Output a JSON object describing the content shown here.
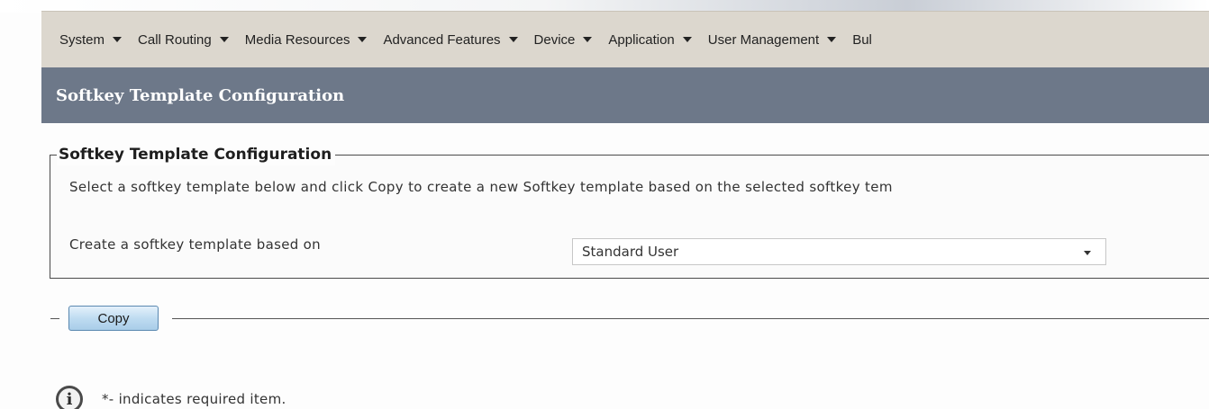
{
  "menubar": {
    "items": [
      {
        "label": "System",
        "icon": "chevron-down-icon"
      },
      {
        "label": "Call Routing",
        "icon": "chevron-down-icon"
      },
      {
        "label": "Media Resources",
        "icon": "chevron-down-icon"
      },
      {
        "label": "Advanced Features",
        "icon": "chevron-down-icon"
      },
      {
        "label": "Device",
        "icon": "chevron-down-icon"
      },
      {
        "label": "Application",
        "icon": "chevron-down-icon"
      },
      {
        "label": "User Management",
        "icon": "chevron-down-icon"
      },
      {
        "label": "Bul",
        "icon": ""
      }
    ]
  },
  "page": {
    "title": "Softkey Template Configuration"
  },
  "section": {
    "legend": "Softkey Template Configuration",
    "description": "Select a softkey template below and click Copy to create a new Softkey template based on the selected softkey tem",
    "field_label": "Create a softkey template based on",
    "select_value": "Standard User",
    "select_icon": "dropdown-arrow-icon"
  },
  "actions": {
    "copy_label": "Copy"
  },
  "footer": {
    "info_icon": "info-icon",
    "info_glyph": "i",
    "required_note": "*- indicates required item."
  },
  "colors": {
    "menubar_bg": "#dcd7ce",
    "title_bar_bg": "#6d7889",
    "button_accent": "#bfdcf1"
  }
}
